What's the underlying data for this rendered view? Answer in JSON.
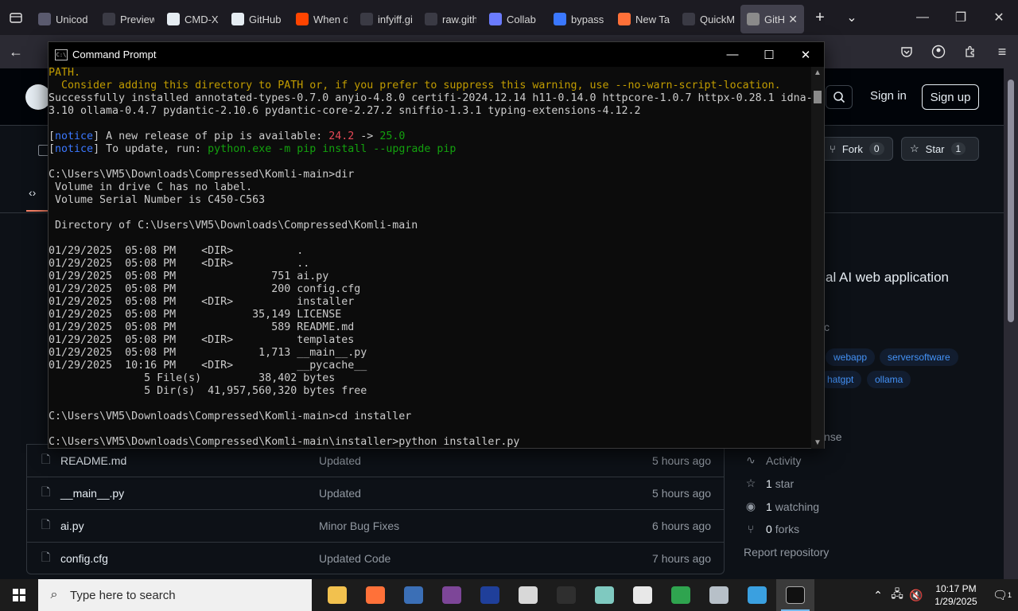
{
  "browser": {
    "tabs": [
      {
        "label": "Unicod",
        "color": "#5a5a6e"
      },
      {
        "label": "Preview Co",
        "color": "#3b3b45"
      },
      {
        "label": "CMD-X",
        "color": "#e6edf3"
      },
      {
        "label": "GitHub",
        "color": "#e6edf3"
      },
      {
        "label": "When d",
        "color": "#ff4500"
      },
      {
        "label": "infyiff.githu",
        "color": "#3b3b45"
      },
      {
        "label": "raw.github",
        "color": "#3b3b45"
      },
      {
        "label": "Collab",
        "color": "#6b7cff"
      },
      {
        "label": "bypass",
        "color": "#3b78ff"
      },
      {
        "label": "New Ta",
        "color": "#ff7139"
      },
      {
        "label": "QuickMash",
        "color": "#3b3b45"
      },
      {
        "label": "GitH",
        "color": "#8b8b8b"
      }
    ],
    "active_tab_close": "✕",
    "new_tab": "+",
    "tab_list": "⌄"
  },
  "github": {
    "sign_in": "Sign in",
    "sign_up": "Sign up",
    "fork_label": "Fork",
    "fork_count": "0",
    "star_label": "Star",
    "star_count": "1",
    "about_desc": "al AI web application",
    "about_partial": "c",
    "topics": [
      "webapp",
      "serversoftware",
      "hatgpt",
      "ollama"
    ],
    "license_partial": "nse",
    "activity": "Activity",
    "stars": "1",
    "stars_suffix": "star",
    "watching": "1",
    "watching_suffix": "watching",
    "forks": "0",
    "forks_suffix": "forks",
    "report": "Report repository",
    "files": [
      {
        "name": "README.md",
        "msg": "Updated",
        "time": "5 hours ago"
      },
      {
        "name": "__main__.py",
        "msg": "Updated",
        "time": "5 hours ago"
      },
      {
        "name": "ai.py",
        "msg": "Minor Bug Fixes",
        "time": "6 hours ago"
      },
      {
        "name": "config.cfg",
        "msg": "Updated Code",
        "time": "7 hours ago"
      }
    ]
  },
  "cmd": {
    "title": "Command Prompt",
    "lines": [
      [
        {
          "t": "PATH.",
          "c": "y"
        }
      ],
      [
        {
          "t": "  Consider adding this directory to PATH or, if you prefer to suppress this warning, use --no-warn-script-location.",
          "c": "y"
        }
      ],
      [
        {
          "t": "Successfully installed annotated-types-0.7.0 anyio-4.8.0 certifi-2024.12.14 h11-0.14.0 httpcore-1.0.7 httpx-0.28.1 idna-"
        }
      ],
      [
        {
          "t": "3.10 ollama-0.4.7 pydantic-2.10.6 pydantic-core-2.27.2 sniffio-1.3.1 typing-extensions-4.12.2"
        }
      ],
      [
        {
          "t": ""
        }
      ],
      [
        {
          "t": "["
        },
        {
          "t": "notice",
          "c": "b"
        },
        {
          "t": "] A new release of pip is available: "
        },
        {
          "t": "24.2",
          "c": "r"
        },
        {
          "t": " -> "
        },
        {
          "t": "25.0",
          "c": "g"
        }
      ],
      [
        {
          "t": "["
        },
        {
          "t": "notice",
          "c": "b"
        },
        {
          "t": "] To update, run: "
        },
        {
          "t": "python.exe -m pip install --upgrade pip",
          "c": "g"
        }
      ],
      [
        {
          "t": ""
        }
      ],
      [
        {
          "t": "C:\\Users\\VM5\\Downloads\\Compressed\\Komli-main>dir"
        }
      ],
      [
        {
          "t": " Volume in drive C has no label."
        }
      ],
      [
        {
          "t": " Volume Serial Number is C450-C563"
        }
      ],
      [
        {
          "t": ""
        }
      ],
      [
        {
          "t": " Directory of C:\\Users\\VM5\\Downloads\\Compressed\\Komli-main"
        }
      ],
      [
        {
          "t": ""
        }
      ],
      [
        {
          "t": "01/29/2025  05:08 PM    <DIR>          ."
        }
      ],
      [
        {
          "t": "01/29/2025  05:08 PM    <DIR>          .."
        }
      ],
      [
        {
          "t": "01/29/2025  05:08 PM               751 ai.py"
        }
      ],
      [
        {
          "t": "01/29/2025  05:08 PM               200 config.cfg"
        }
      ],
      [
        {
          "t": "01/29/2025  05:08 PM    <DIR>          installer"
        }
      ],
      [
        {
          "t": "01/29/2025  05:08 PM            35,149 LICENSE"
        }
      ],
      [
        {
          "t": "01/29/2025  05:08 PM               589 README.md"
        }
      ],
      [
        {
          "t": "01/29/2025  05:08 PM    <DIR>          templates"
        }
      ],
      [
        {
          "t": "01/29/2025  05:08 PM             1,713 __main__.py"
        }
      ],
      [
        {
          "t": "01/29/2025  10:16 PM    <DIR>          __pycache__"
        }
      ],
      [
        {
          "t": "               5 File(s)         38,402 bytes"
        }
      ],
      [
        {
          "t": "               5 Dir(s)  41,957,560,320 bytes free"
        }
      ],
      [
        {
          "t": ""
        }
      ],
      [
        {
          "t": "C:\\Users\\VM5\\Downloads\\Compressed\\Komli-main>cd installer"
        }
      ],
      [
        {
          "t": ""
        }
      ],
      [
        {
          "t": "C:\\Users\\VM5\\Downloads\\Compressed\\Komli-main\\installer>python installer.py"
        }
      ]
    ]
  },
  "taskbar": {
    "search_placeholder": "Type here to search",
    "apps": [
      {
        "name": "file-explorer",
        "color": "#f2c14e"
      },
      {
        "name": "firefox",
        "color": "#ff7139"
      },
      {
        "name": "app-2025",
        "color": "#3b6fb6"
      },
      {
        "name": "tor-browser",
        "color": "#7d4698"
      },
      {
        "name": "app-blue",
        "color": "#1f3f9a"
      },
      {
        "name": "roblox",
        "color": "#d8d8d8"
      },
      {
        "name": "app-star",
        "color": "#2f2f2f"
      },
      {
        "name": "app-green",
        "color": "#7fc9c0"
      },
      {
        "name": "7zip",
        "color": "#e8e8e8"
      },
      {
        "name": "edge",
        "color": "#2fa44f"
      },
      {
        "name": "app-gray",
        "color": "#b7c0c8"
      },
      {
        "name": "app-globe",
        "color": "#3aa0e0"
      },
      {
        "name": "command-prompt",
        "color": "#111111"
      }
    ],
    "time": "10:17 PM",
    "date": "1/29/2025",
    "notif_count": "1"
  }
}
